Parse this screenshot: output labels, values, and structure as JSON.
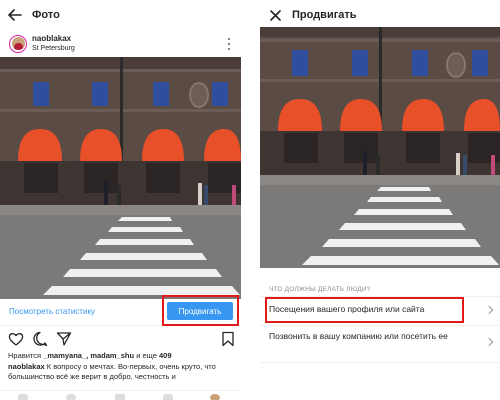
{
  "left": {
    "header": {
      "title": "Фото"
    },
    "post": {
      "username": "naoblakax",
      "location": "St Petersburg",
      "stats_link": "Посмотреть статистику",
      "promote_label": "Продвигать",
      "likes_prefix": "Нравится",
      "likes_users": "_mamyana_, madam_shu",
      "likes_and": "и еще",
      "likes_count": "409",
      "caption_user": "naoblakax",
      "caption_text": "К вопросу о мечтах. Во-первых, очень круто, что большинство всё же верит в добро, честность и"
    },
    "nav_icons": [
      "home-icon",
      "search-icon",
      "add-icon",
      "activity-icon",
      "profile-icon"
    ]
  },
  "right": {
    "header": {
      "title": "Продвигать"
    },
    "question": "ЧТО ДОЛЖНЫ ДЕЛАТЬ ЛЮДИ?",
    "options": [
      {
        "label": "Посещения вашего профиля или сайта"
      },
      {
        "label": "Позвонить в вашу компанию или посетить ее"
      }
    ]
  },
  "colors": {
    "accent": "#3897f0",
    "highlight": "#e11919",
    "awning": "#e8502a",
    "facade": "#5a4b45"
  }
}
